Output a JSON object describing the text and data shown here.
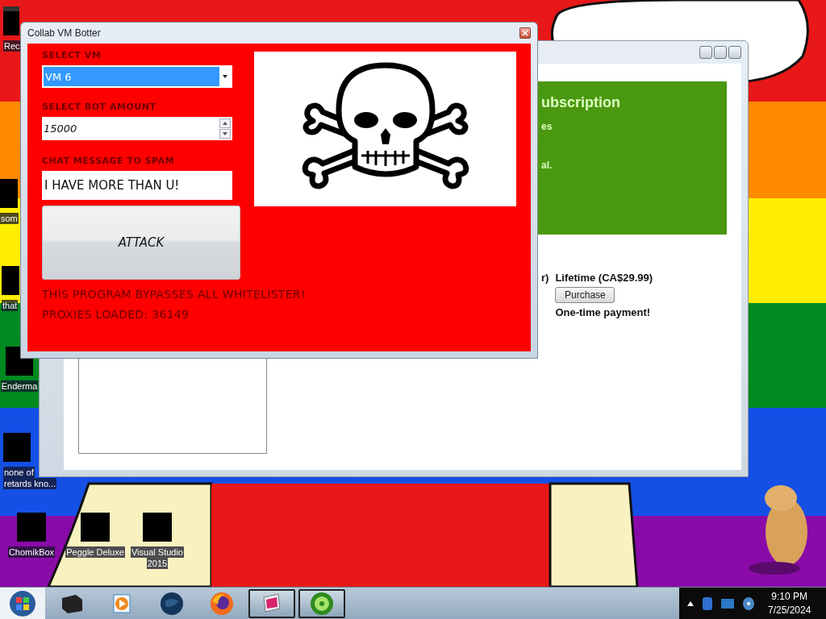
{
  "desktop": {
    "icons": [
      {
        "label": [
          "Rec"
        ],
        "kind": "bin"
      },
      {
        "label": [
          "som"
        ],
        "kind": "app"
      },
      {
        "label": [
          "that"
        ],
        "kind": "app"
      },
      {
        "label": [
          "Enderma"
        ],
        "kind": "app"
      },
      {
        "label": [
          "none of",
          "retards kno..."
        ],
        "kind": "app"
      },
      {
        "label": [
          "ChomikBox"
        ],
        "kind": "app"
      },
      {
        "label": [
          "Peggle Deluxe"
        ],
        "kind": "app"
      },
      {
        "label": [
          "Visual Studio",
          "2015"
        ],
        "kind": "app"
      }
    ]
  },
  "purchase_window": {
    "heading": "ubscription",
    "lines": [
      "es",
      "al."
    ],
    "plan_fragment": "r)",
    "plan": {
      "title": "Lifetime (CA$29.99)",
      "button": "Purchase",
      "note": "One-time payment!"
    }
  },
  "botter_window": {
    "title": "Collab VM Botter",
    "vm_label": "SELECT VM",
    "vm_value": "VM 6",
    "amount_label": "SELECT BOT AMOUNT",
    "amount_value": "15000",
    "message_label": "CHAT MESSAGE TO SPAM",
    "message_value": "I HAVE MORE THAN U!",
    "button": "ATTACK",
    "notes": [
      "THIS PROGRAM BYPASSES ALL WHITELISTER!",
      "PROXIES LOADED: 36149"
    ]
  },
  "taskbar": {
    "items": [
      {
        "kind": "box",
        "active": false
      },
      {
        "kind": "player",
        "active": false
      },
      {
        "kind": "globe",
        "active": false
      },
      {
        "kind": "browser",
        "active": false
      },
      {
        "kind": "monitor",
        "active": true
      },
      {
        "kind": "wheel",
        "active": true
      }
    ],
    "clock": {
      "time": "9:10 PM",
      "date": "7/25/2024"
    }
  }
}
